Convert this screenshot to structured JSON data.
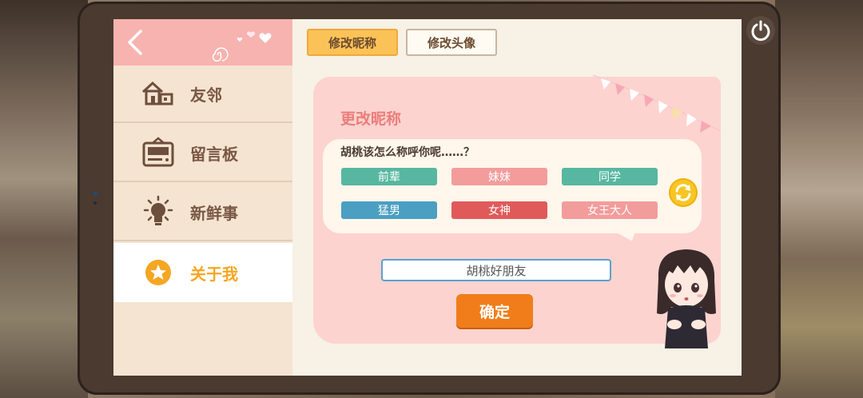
{
  "sidebar": {
    "items": [
      {
        "label": "友邻",
        "icon": "house-icon"
      },
      {
        "label": "留言板",
        "icon": "message-board-icon"
      },
      {
        "label": "新鲜事",
        "icon": "lightbulb-icon"
      },
      {
        "label": "关于我",
        "icon": "star-icon",
        "active": true
      }
    ]
  },
  "tabs": [
    {
      "label": "修改昵称",
      "active": true
    },
    {
      "label": "修改头像",
      "active": false
    }
  ],
  "panel": {
    "title": "更改昵称",
    "question": "胡桃该怎么称呼你呢……？",
    "options": [
      {
        "label": "前辈",
        "color": "#57b7a0"
      },
      {
        "label": "妹妹",
        "color": "#f39c9c"
      },
      {
        "label": "同学",
        "color": "#57b7a0"
      },
      {
        "label": "猛男",
        "color": "#4a9fc2"
      },
      {
        "label": "女神",
        "color": "#e15a5a"
      },
      {
        "label": "女王大人",
        "color": "#f39c9c"
      }
    ],
    "input_value": "胡桃好朋友",
    "confirm_label": "确定"
  },
  "colors": {
    "accent": "#f5a623",
    "header_pink": "#f7b3b0",
    "confirm_orange": "#f07d1a"
  }
}
